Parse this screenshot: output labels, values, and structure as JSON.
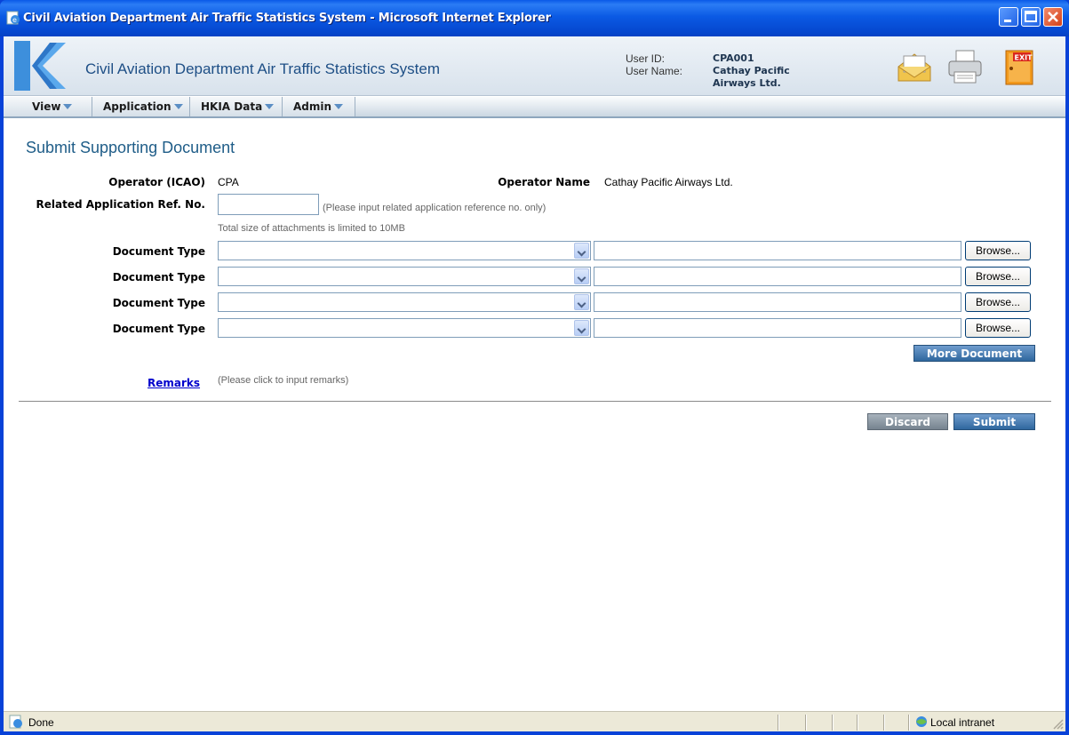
{
  "window": {
    "title": "Civil Aviation Department Air Traffic Statistics System - Microsoft Internet Explorer"
  },
  "header": {
    "app_title": "Civil Aviation Department Air Traffic Statistics System",
    "user_id_label": "User ID:",
    "user_id": "CPA001",
    "user_name_label": "User Name:",
    "user_name_line1": "Cathay Pacific",
    "user_name_line2": "Airways Ltd.",
    "icons": [
      "mail-icon",
      "printer-icon",
      "exit-icon"
    ],
    "exit_text": "EXIT"
  },
  "menu": {
    "items": [
      {
        "label": "View"
      },
      {
        "label": "Application"
      },
      {
        "label": "HKIA Data"
      },
      {
        "label": "Admin"
      }
    ]
  },
  "form": {
    "page_title": "Submit Supporting Document",
    "operator_icao_label": "Operator (ICAO)",
    "operator_icao": "CPA",
    "operator_name_label": "Operator Name",
    "operator_name": "Cathay Pacific Airways Ltd.",
    "ref_no_label": "Related Application Ref. No.",
    "ref_no_value": "",
    "ref_no_hint": "(Please input related application reference no. only)",
    "size_hint": "Total size of attachments is limited to 10MB",
    "document_rows": [
      {
        "label": "Document Type",
        "selected": "",
        "file": "",
        "browse": "Browse..."
      },
      {
        "label": "Document Type",
        "selected": "",
        "file": "",
        "browse": "Browse..."
      },
      {
        "label": "Document Type",
        "selected": "",
        "file": "",
        "browse": "Browse..."
      },
      {
        "label": "Document Type",
        "selected": "",
        "file": "",
        "browse": "Browse..."
      }
    ],
    "more_document": "More Document",
    "remarks_link": "Remarks",
    "remarks_hint": "(Please click to input remarks)",
    "discard": "Discard",
    "submit": "Submit"
  },
  "status": {
    "text": "Done",
    "zone": "Local intranet"
  },
  "colors": {
    "title_blue": "#1f5d88",
    "button_blue": "#2f679e",
    "link": "#0000cc"
  }
}
